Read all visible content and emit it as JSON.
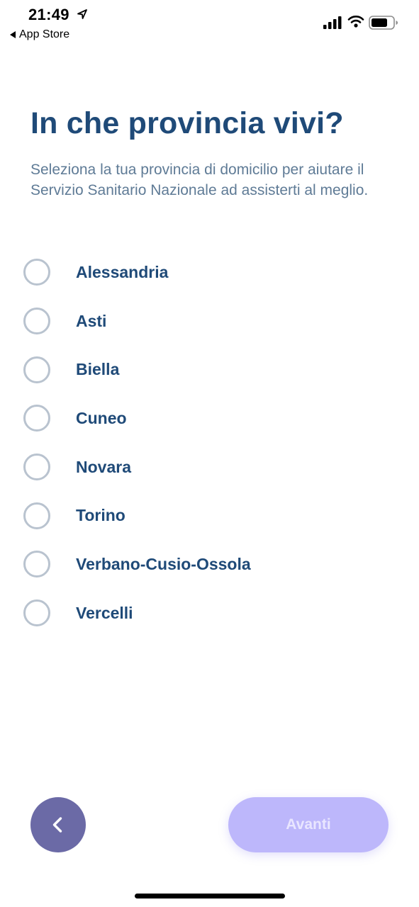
{
  "status_bar": {
    "time": "21:49",
    "back_app_label": "App Store",
    "icons": [
      "location-arrow-icon",
      "cellular-signal-icon",
      "wifi-icon",
      "battery-icon"
    ]
  },
  "header": {
    "title": "In che provincia vivi?",
    "subtitle": "Seleziona la tua provincia di domicilio per aiutare il Servizio Sanitario Nazionale ad assisterti al meglio."
  },
  "options": [
    {
      "label": "Alessandria",
      "selected": false
    },
    {
      "label": "Asti",
      "selected": false
    },
    {
      "label": "Biella",
      "selected": false
    },
    {
      "label": "Cuneo",
      "selected": false
    },
    {
      "label": "Novara",
      "selected": false
    },
    {
      "label": "Torino",
      "selected": false
    },
    {
      "label": "Verbano-Cusio-Ossola",
      "selected": false
    },
    {
      "label": "Vercelli",
      "selected": false
    }
  ],
  "footer": {
    "back_icon": "chevron-left-icon",
    "next_label": "Avanti",
    "next_enabled": false
  },
  "colors": {
    "title": "#1f4a78",
    "subtitle": "#5f7b96",
    "radio_border": "#b9c3cf",
    "back_button": "#6b6aa6",
    "next_button_disabled": "#bdb7fb"
  }
}
